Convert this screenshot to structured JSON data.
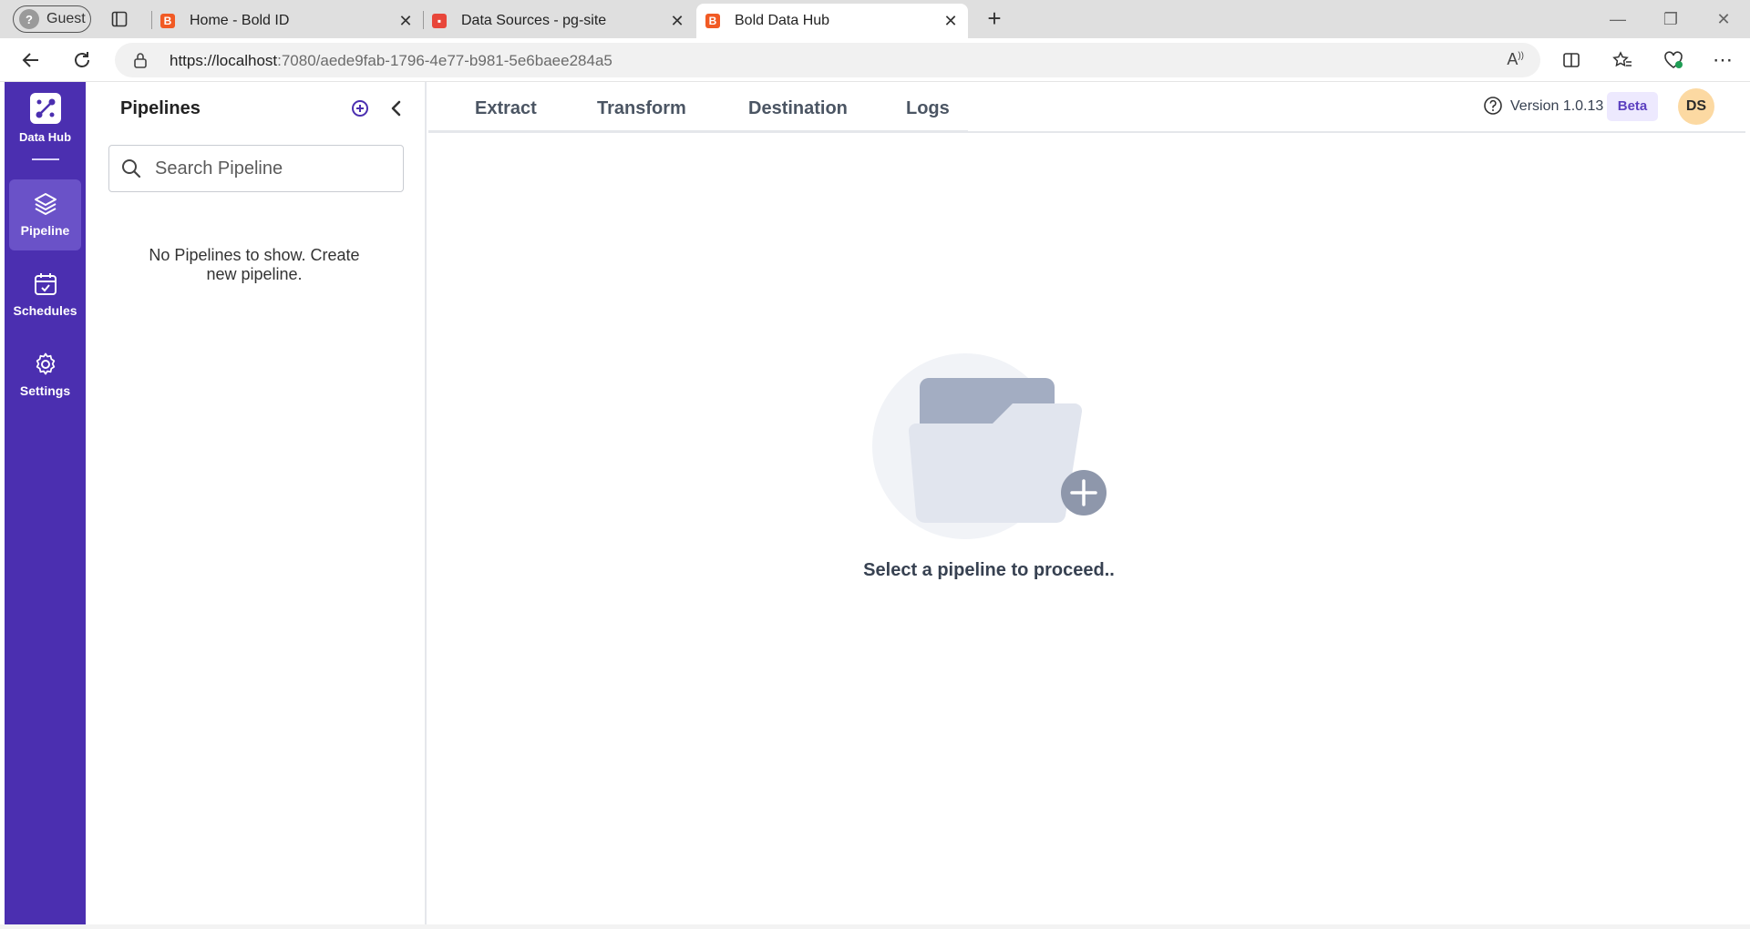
{
  "browser": {
    "profile_label": "Guest",
    "tabs": [
      {
        "title": "Home - Bold ID"
      },
      {
        "title": "Data Sources - pg-site"
      },
      {
        "title": "Bold Data Hub"
      }
    ],
    "url_host": "https://localhost",
    "url_path": ":7080/aede9fab-1796-4e77-b981-5e6baee284a5"
  },
  "nav": {
    "logo_label": "Data Hub",
    "items": [
      {
        "label": "Pipeline",
        "icon": "layers-icon",
        "active": true
      },
      {
        "label": "Schedules",
        "icon": "calendar-check-icon",
        "active": false
      },
      {
        "label": "Settings",
        "icon": "gear-icon",
        "active": false
      }
    ]
  },
  "pipelines": {
    "title": "Pipelines",
    "search_placeholder": "Search Pipeline",
    "empty_text": "No Pipelines to show. Create new pipeline."
  },
  "main": {
    "tabs": [
      {
        "label": "Extract"
      },
      {
        "label": "Transform"
      },
      {
        "label": "Destination"
      },
      {
        "label": "Logs"
      }
    ],
    "version": "Version 1.0.13",
    "beta": "Beta",
    "user_initials": "DS",
    "empty_message": "Select a pipeline to proceed.."
  },
  "colors": {
    "nav_bg": "#4b2fb0",
    "nav_active": "#6a52c8",
    "avatar_bg": "#fcd9a2"
  }
}
